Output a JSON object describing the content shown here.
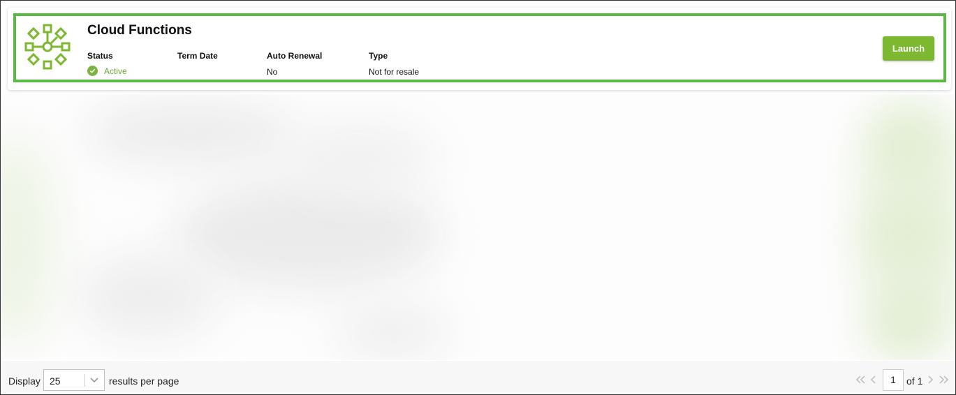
{
  "product": {
    "title": "Cloud Functions",
    "icon": "network-nodes-icon",
    "launch_label": "Launch"
  },
  "fields": {
    "status_label": "Status",
    "status_value": "Active",
    "term_date_label": "Term Date",
    "term_date_value": "",
    "auto_renewal_label": "Auto Renewal",
    "auto_renewal_value": "No",
    "type_label": "Type",
    "type_value": "Not for resale"
  },
  "footer": {
    "display_label": "Display",
    "page_size": "25",
    "results_per_page": "results per page",
    "current_page": "1",
    "of_pages": "of 1"
  },
  "colors": {
    "accent": "#7cb931",
    "highlight": "#5cb946",
    "status_active": "#6aa93a"
  }
}
